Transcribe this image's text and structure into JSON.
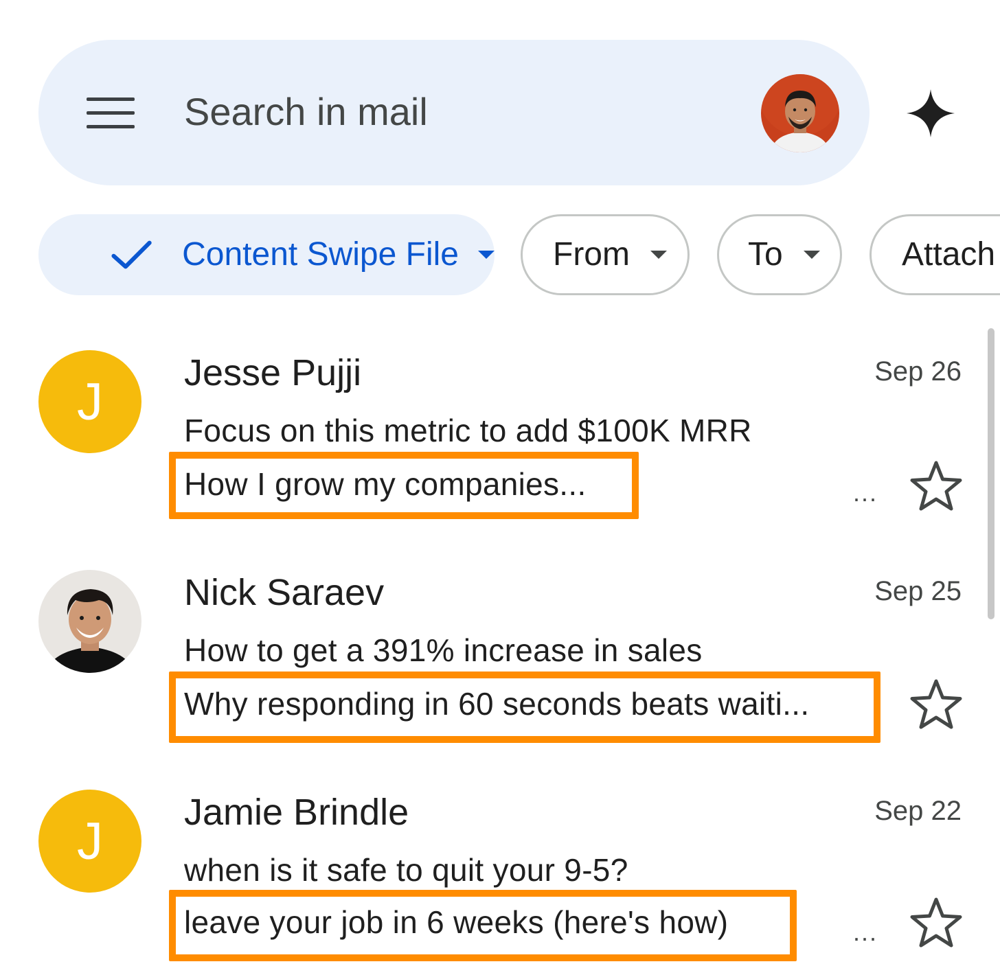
{
  "search": {
    "placeholder": "Search in mail"
  },
  "chips": [
    {
      "label": "Content Swipe File",
      "selected": true
    },
    {
      "label": "From"
    },
    {
      "label": "To"
    },
    {
      "label": "Attach"
    }
  ],
  "emails": [
    {
      "sender": "Jesse Pujji",
      "avatar_letter": "J",
      "date": "Sep 26",
      "subject": "Focus on this metric to add $100K MRR",
      "snippet": "How I grow my companies...",
      "more": "...",
      "starred": false
    },
    {
      "sender": "Nick Saraev",
      "avatar_letter": "",
      "date": "Sep 25",
      "subject": "How to get a 391% increase in sales",
      "snippet": "Why responding in 60 seconds beats waiti...",
      "more": "",
      "starred": false
    },
    {
      "sender": "Jamie Brindle",
      "avatar_letter": "J",
      "date": "Sep 22",
      "subject": "when is it safe to quit your 9-5?",
      "snippet": "leave your job in 6 weeks (here's how)",
      "more": "...",
      "starred": false
    }
  ],
  "colors": {
    "highlight": "#ff8c00",
    "accent": "#0b57d0",
    "avatar_yellow": "#f6bb0c",
    "search_bg": "#eaf1fb"
  },
  "icons": [
    "menu-icon",
    "gemini-sparkle-icon",
    "check-icon",
    "caret-down-icon",
    "star-icon"
  ]
}
